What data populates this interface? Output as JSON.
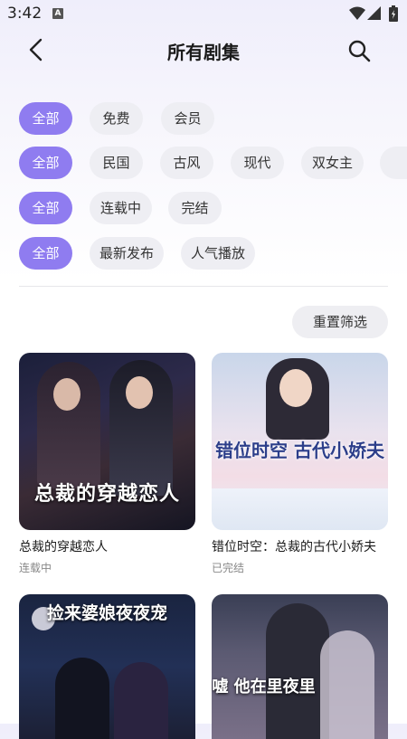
{
  "status_bar": {
    "time": "3:42",
    "notif_icon": "A"
  },
  "header": {
    "title": "所有剧集"
  },
  "filters": {
    "row1": [
      "全部",
      "免费",
      "会员"
    ],
    "row2": [
      "全部",
      "民国",
      "古风",
      "现代",
      "双女主"
    ],
    "row3": [
      "全部",
      "连载中",
      "完结"
    ],
    "row4": [
      "全部",
      "最新发布",
      "人气播放"
    ]
  },
  "reset_label": "重置筛选",
  "dramas": [
    {
      "title": "总裁的穿越恋人",
      "status": "连载中",
      "cover_text": "总裁的穿越恋人"
    },
    {
      "title": "错位时空：总裁的古代小娇夫",
      "status": "已完结",
      "cover_text": "错位时空 古代小娇夫"
    },
    {
      "title": "",
      "status": "",
      "cover_text": "捡来婆娘夜夜宠"
    },
    {
      "title": "",
      "status": "",
      "cover_text": "嘘 他在里夜里"
    }
  ],
  "colors": {
    "accent": "#8f7cf0",
    "chip_bg": "#eeeef3"
  }
}
